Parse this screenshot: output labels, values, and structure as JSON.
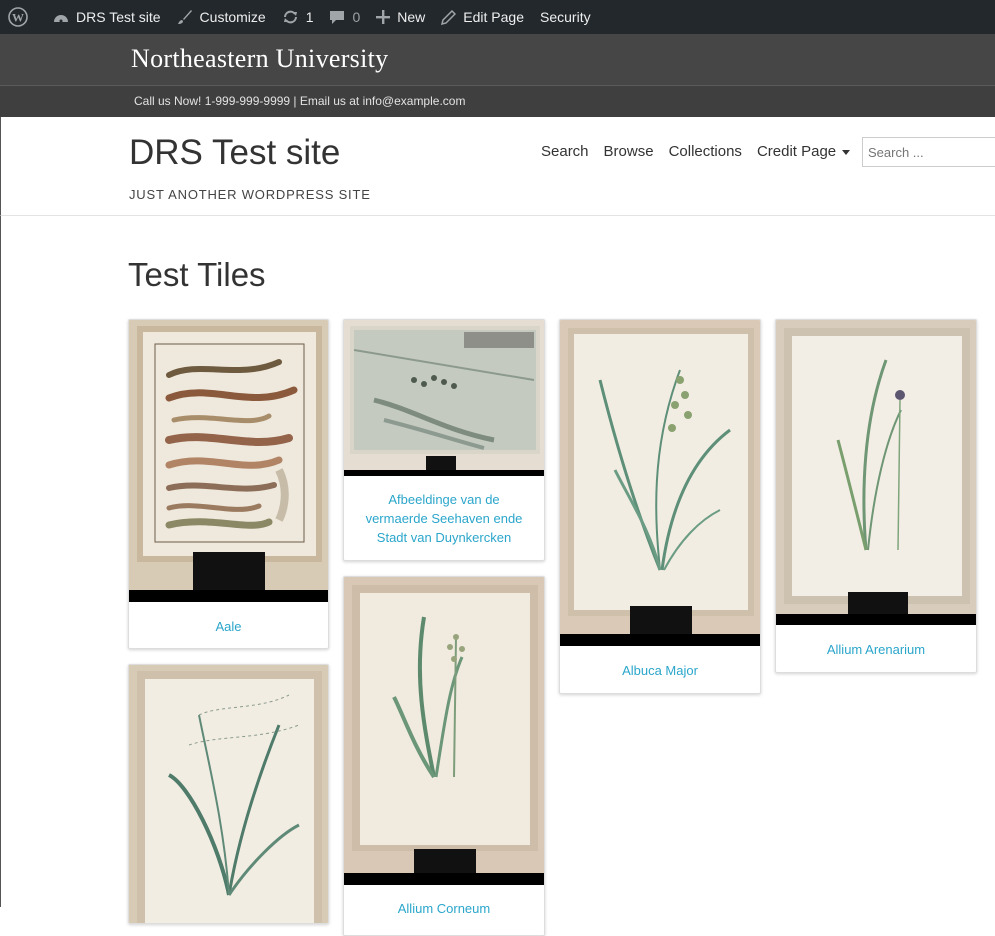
{
  "adminbar": {
    "site_name": "DRS Test site",
    "customize": "Customize",
    "updates_count": "1",
    "comments_count": "0",
    "new_label": "New",
    "edit_page": "Edit Page",
    "security": "Security"
  },
  "university": {
    "name": "Northeastern University",
    "contact": "Call us Now! 1-999-999-9999 | Email us at info@example.com"
  },
  "site": {
    "title": "DRS Test site",
    "description": "JUST ANOTHER WORDPRESS SITE"
  },
  "nav": {
    "items": [
      "Search",
      "Browse",
      "Collections",
      "Credit Page"
    ],
    "search_placeholder": "Search ..."
  },
  "page": {
    "title": "Test Tiles"
  },
  "tiles": [
    {
      "caption": "Aale"
    },
    {
      "caption": "Afbeeldinge van de vermaerde Seehaven ende Stadt van Duynkercken"
    },
    {
      "caption": "Albuca Major"
    },
    {
      "caption": "Allium Arenarium"
    },
    {
      "caption": ""
    },
    {
      "caption": "Allium Corneum"
    }
  ],
  "colors": {
    "adminbar_bg": "#23282d",
    "nu_header_bg": "#464646",
    "link_color": "#2ba6cb"
  }
}
